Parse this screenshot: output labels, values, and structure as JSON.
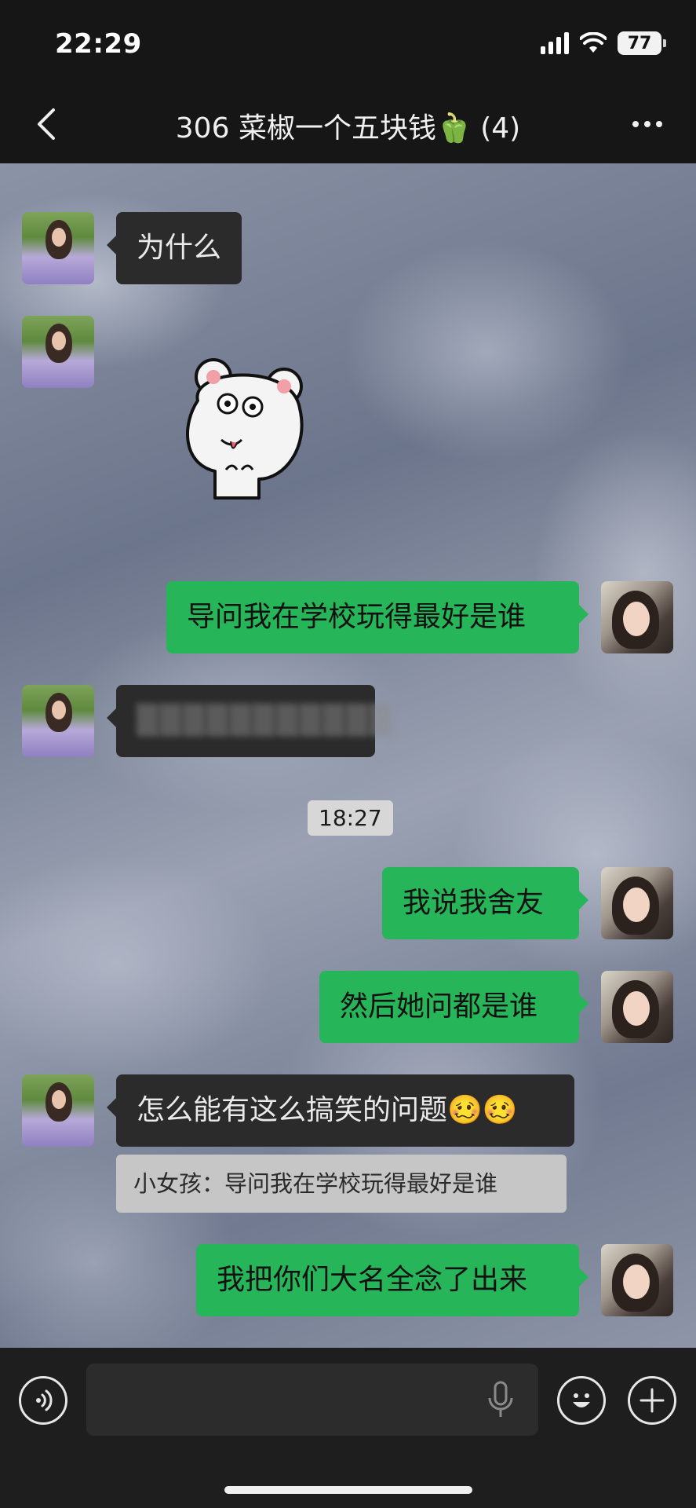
{
  "status_bar": {
    "time": "22:29",
    "battery": "77"
  },
  "nav": {
    "title": "306 菜椒一个五块钱🫑 (4)"
  },
  "messages": {
    "m1": "为什么",
    "m3": "导问我在学校玩得最好是谁",
    "m4": "▒▒▒▒▒▒▒▒▒▒▒",
    "m5": "我说我舍友",
    "m6": "然后她问都是谁",
    "m7": "怎么能有这么搞笑的问题🥴🥴",
    "m7_quote": "小女孩：导问我在学校玩得最好是谁",
    "m8": "我把你们大名全念了出来"
  },
  "timestamp": "18:27",
  "icons": {
    "back": "chevron-left-icon",
    "more": "more-dots-icon",
    "voice": "voice-icon",
    "mic": "mic-icon",
    "emoji": "emoji-icon",
    "plus": "plus-icon"
  },
  "colors": {
    "self_bubble": "#26b559",
    "other_bubble": "#2b2b2b",
    "bar": "#161616"
  }
}
